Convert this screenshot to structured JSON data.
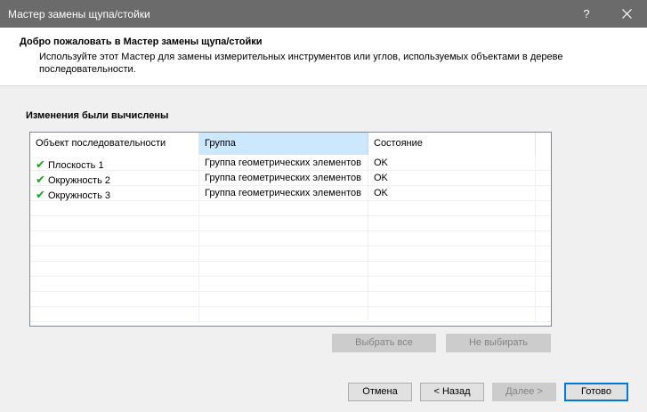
{
  "window": {
    "title": "Мастер замены щупа/стойки",
    "help_label": "?"
  },
  "header": {
    "title": "Добро пожаловать в Мастер замены щупа/стойки",
    "description": "Используйте этот Мастер для замены измерительных инструментов или углов, используемых объектами в дереве последовательности."
  },
  "section": {
    "title": "Изменения были вычислены"
  },
  "table": {
    "columns": [
      "Объект последовательности",
      "Группа",
      "Состояние"
    ],
    "rows": [
      {
        "object": "Плоскость 1",
        "group": "Группа геометрических элементов",
        "status": "OK"
      },
      {
        "object": "Окружность 2",
        "group": "Группа геометрических элементов",
        "status": "OK"
      },
      {
        "object": "Окружность 3",
        "group": "Группа геометрических элементов",
        "status": "OK"
      }
    ]
  },
  "selection_buttons": {
    "select_all": "Выбрать все",
    "select_none": "Не выбирать"
  },
  "footer": {
    "cancel": "Отмена",
    "back": "< Назад",
    "next": "Далее >",
    "finish": "Готово"
  },
  "colors": {
    "titlebar": "#6b6b6b",
    "accent": "#0078d7",
    "check": "#1aa31a",
    "header_selected": "#cce8ff"
  }
}
